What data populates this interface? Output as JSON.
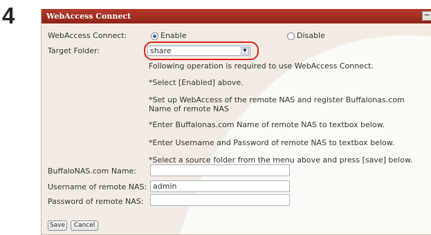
{
  "step": "4",
  "panel": {
    "title": "WebAccess Connect",
    "collapse_glyph": "−"
  },
  "webaccess": {
    "label": "WebAccess Connect:",
    "options": [
      {
        "label": "Enable",
        "selected": true
      },
      {
        "label": "Disable",
        "selected": false
      }
    ]
  },
  "target_folder": {
    "label": "Target Folder:",
    "value": "share"
  },
  "info_lines": [
    "Following operation is required to use WebAccess Connect.",
    "*Select [Enabled] above.",
    "*Set up WebAccess of the remote NAS and register Buffalonas.com Name of remote NAS",
    "*Enter Buffalonas.com Name of remote NAS to textbox below.",
    "*Enter Username and Password of remote NAS to textbox below.",
    "*Select a source folder from the menu above and press [save] below."
  ],
  "fields": [
    {
      "label": "BuffaloNAS.com Name:",
      "value": ""
    },
    {
      "label": "Username of remote NAS:",
      "value": "admin"
    },
    {
      "label": "Password of remote NAS:",
      "value": ""
    }
  ],
  "buttons": {
    "save": "Save",
    "cancel": "Cancel"
  },
  "colors": {
    "titlebar": "#a1301f",
    "highlight": "#e0201b",
    "radio_selected": "#2b5fb3"
  },
  "icons": {
    "dropdown": "chevron-down-icon",
    "collapse": "minus-icon"
  }
}
